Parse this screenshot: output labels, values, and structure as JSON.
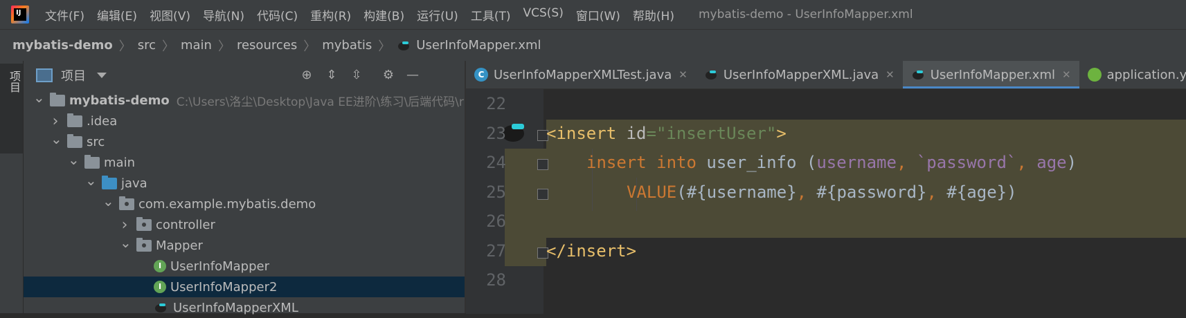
{
  "menubar": {
    "logo_text": "IJ",
    "items": [
      "文件(F)",
      "编辑(E)",
      "视图(V)",
      "导航(N)",
      "代码(C)",
      "重构(R)",
      "构建(B)",
      "运行(U)",
      "工具(T)",
      "VCS(S)",
      "窗口(W)",
      "帮助(H)"
    ],
    "window_title": "mybatis-demo - UserInfoMapper.xml"
  },
  "breadcrumbs": [
    "mybatis-demo",
    "src",
    "main",
    "resources",
    "mybatis",
    "UserInfoMapper.xml"
  ],
  "side_strip": {
    "tab_label": "项目"
  },
  "project_panel": {
    "title": "项目",
    "tools": [
      "locate-icon",
      "expand-all-icon",
      "collapse-all-icon",
      "gear-icon",
      "minimize-icon"
    ],
    "tree": [
      {
        "label": "mybatis-demo",
        "path": "C:\\Users\\洛尘\\Desktop\\Java EE进阶\\练习\\后端代码\\r",
        "indent": 0,
        "arrow": "down",
        "icon": "module-folder",
        "bold": true
      },
      {
        "label": ".idea",
        "indent": 1,
        "arrow": "right",
        "icon": "folder"
      },
      {
        "label": "src",
        "indent": 1,
        "arrow": "down",
        "icon": "folder"
      },
      {
        "label": "main",
        "indent": 2,
        "arrow": "down",
        "icon": "folder"
      },
      {
        "label": "java",
        "indent": 3,
        "arrow": "down",
        "icon": "source-folder"
      },
      {
        "label": "com.example.mybatis.demo",
        "indent": 4,
        "arrow": "down",
        "icon": "package"
      },
      {
        "label": "controller",
        "indent": 5,
        "arrow": "right",
        "icon": "package"
      },
      {
        "label": "Mapper",
        "indent": 5,
        "arrow": "down",
        "icon": "package"
      },
      {
        "label": "UserInfoMapper",
        "indent": 6,
        "arrow": "",
        "icon": "interface"
      },
      {
        "label": "UserInfoMapper2",
        "indent": 6,
        "arrow": "",
        "icon": "interface",
        "selected": true
      },
      {
        "label": "UserInfoMapperXML",
        "indent": 6,
        "arrow": "",
        "icon": "mybatis"
      }
    ]
  },
  "editor": {
    "tabs": [
      {
        "label": "UserInfoMapperXMLTest.java",
        "icon": "java-class",
        "active": false,
        "closable": true
      },
      {
        "label": "UserInfoMapperXML.java",
        "icon": "mybatis",
        "active": false,
        "closable": true
      },
      {
        "label": "UserInfoMapper.xml",
        "icon": "mybatis",
        "active": true,
        "closable": true
      },
      {
        "label": "application.yml",
        "icon": "spring",
        "active": false,
        "closable": false
      }
    ],
    "lines": [
      {
        "num": "22",
        "tokens": []
      },
      {
        "num": "23",
        "tokens": [
          [
            "t",
            "<insert "
          ],
          [
            "a",
            "id"
          ],
          [
            "s",
            "=\"insertUser\""
          ],
          [
            "t",
            ">"
          ]
        ]
      },
      {
        "num": "24",
        "tokens": [
          [
            "k",
            "insert into "
          ],
          [
            "",
            "user_info ("
          ],
          [
            "p",
            "username"
          ],
          [
            "k",
            ", "
          ],
          [
            "p",
            "`password`"
          ],
          [
            "k",
            ", "
          ],
          [
            "p",
            "age"
          ],
          [
            "",
            ")"
          ]
        ]
      },
      {
        "num": "25",
        "tokens": [
          [
            "k",
            "VALUE"
          ],
          [
            "",
            "(#{username}"
          ],
          [
            "k",
            ", "
          ],
          [
            "",
            "#{password}"
          ],
          [
            "k",
            ", "
          ],
          [
            "",
            "#{age})"
          ]
        ]
      },
      {
        "num": "26",
        "tokens": []
      },
      {
        "num": "27",
        "tokens": [
          [
            "t",
            "</insert>"
          ]
        ]
      },
      {
        "num": "28",
        "tokens": []
      }
    ]
  },
  "colors": {
    "bg": "#2b2b2b",
    "panel": "#3c3f41",
    "selection": "#0d293e",
    "highlight": "#4c4a36",
    "accent": "#4a88c7"
  }
}
